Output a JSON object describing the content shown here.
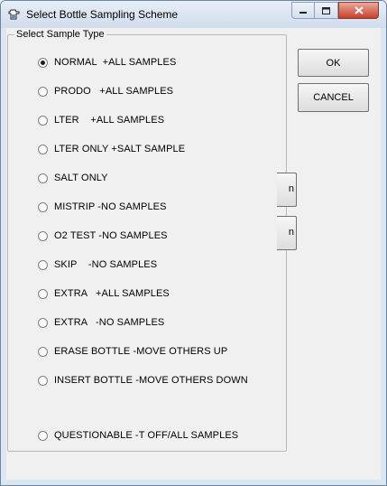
{
  "window": {
    "title": "Select Bottle Sampling Scheme",
    "icons": {
      "app": "bottle-app-icon",
      "minimize": "minimize-icon",
      "maximize": "maximize-icon",
      "close": "close-icon"
    }
  },
  "group": {
    "label": "Select Sample Type",
    "selected_index": 0,
    "options": [
      {
        "label": "NORMAL  +ALL SAMPLES"
      },
      {
        "label": "PRODO   +ALL SAMPLES"
      },
      {
        "label": "LTER    +ALL SAMPLES"
      },
      {
        "label": "LTER ONLY +SALT SAMPLE"
      },
      {
        "label": "SALT ONLY"
      },
      {
        "label": "MISTRIP -NO SAMPLES"
      },
      {
        "label": "O2 TEST -NO SAMPLES"
      },
      {
        "label": "SKIP    -NO SAMPLES"
      },
      {
        "label": "EXTRA   +ALL SAMPLES"
      },
      {
        "label": "EXTRA   -NO SAMPLES"
      },
      {
        "label": "ERASE BOTTLE -MOVE OTHERS UP"
      },
      {
        "label": "INSERT BOTTLE -MOVE OTHERS DOWN"
      },
      {
        "label": "QUESTIONABLE -T OFF/ALL SAMPLES"
      }
    ]
  },
  "buttons": {
    "ok": "OK",
    "cancel": "CANCEL",
    "hidden_button_1_fragment": "n",
    "hidden_button_2_fragment": "n"
  }
}
